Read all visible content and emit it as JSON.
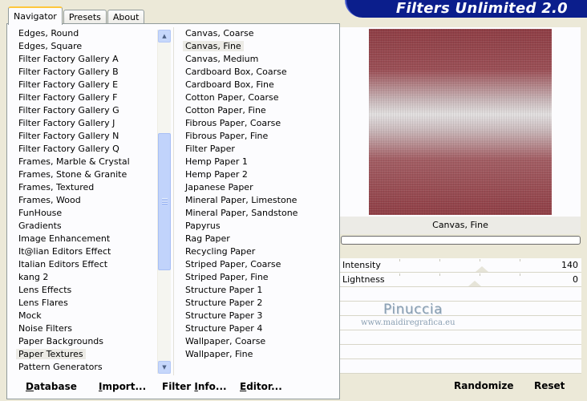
{
  "tabs": [
    {
      "label": "Navigator",
      "active": true
    },
    {
      "label": "Presets",
      "active": false
    },
    {
      "label": "About",
      "active": false
    }
  ],
  "app_title": "Filters Unlimited 2.0",
  "categories": [
    "Edges, Round",
    "Edges, Square",
    "Filter Factory Gallery A",
    "Filter Factory Gallery B",
    "Filter Factory Gallery E",
    "Filter Factory Gallery F",
    "Filter Factory Gallery G",
    "Filter Factory Gallery J",
    "Filter Factory Gallery N",
    "Filter Factory Gallery Q",
    "Frames, Marble & Crystal",
    "Frames, Stone & Granite",
    "Frames, Textured",
    "Frames, Wood",
    "FunHouse",
    "Gradients",
    "Image Enhancement",
    "It@lian Editors Effect",
    "Italian Editors Effect",
    "kang 2",
    "Lens Effects",
    "Lens Flares",
    "Mock",
    "Noise Filters",
    "Paper Backgrounds",
    "Paper Textures",
    "Pattern Generators"
  ],
  "selected_category": "Paper Textures",
  "filters": [
    "Canvas, Coarse",
    "Canvas, Fine",
    "Canvas, Medium",
    "Cardboard Box, Coarse",
    "Cardboard Box, Fine",
    "Cotton Paper, Coarse",
    "Cotton Paper, Fine",
    "Fibrous Paper, Coarse",
    "Fibrous Paper, Fine",
    "Filter Paper",
    "Hemp Paper 1",
    "Hemp Paper 2",
    "Japanese Paper",
    "Mineral Paper, Limestone",
    "Mineral Paper, Sandstone",
    "Papyrus",
    "Rag Paper",
    "Recycling Paper",
    "Striped Paper, Coarse",
    "Striped Paper, Fine",
    "Structure Paper 1",
    "Structure Paper 2",
    "Structure Paper 3",
    "Structure Paper 4",
    "Wallpaper, Coarse",
    "Wallpaper, Fine"
  ],
  "selected_filter": "Canvas, Fine",
  "preview_filter_name": "Canvas, Fine",
  "sliders": [
    {
      "label": "Intensity",
      "value": "140",
      "level": 0.549
    },
    {
      "label": "Lightness",
      "value": "0",
      "level": 0.5
    }
  ],
  "watermark": {
    "name": "Pinuccia",
    "url": "www.maidiregrafica.eu"
  },
  "buttons": {
    "database": {
      "accel": "D",
      "rest": "atabase"
    },
    "import": {
      "accel": "I",
      "rest": "mport..."
    },
    "filter_info": {
      "pre": "Filter ",
      "accel": "I",
      "rest": "nfo..."
    },
    "editor": {
      "accel": "E",
      "rest": "ditor..."
    },
    "randomize": "Randomize",
    "reset": "Reset"
  }
}
